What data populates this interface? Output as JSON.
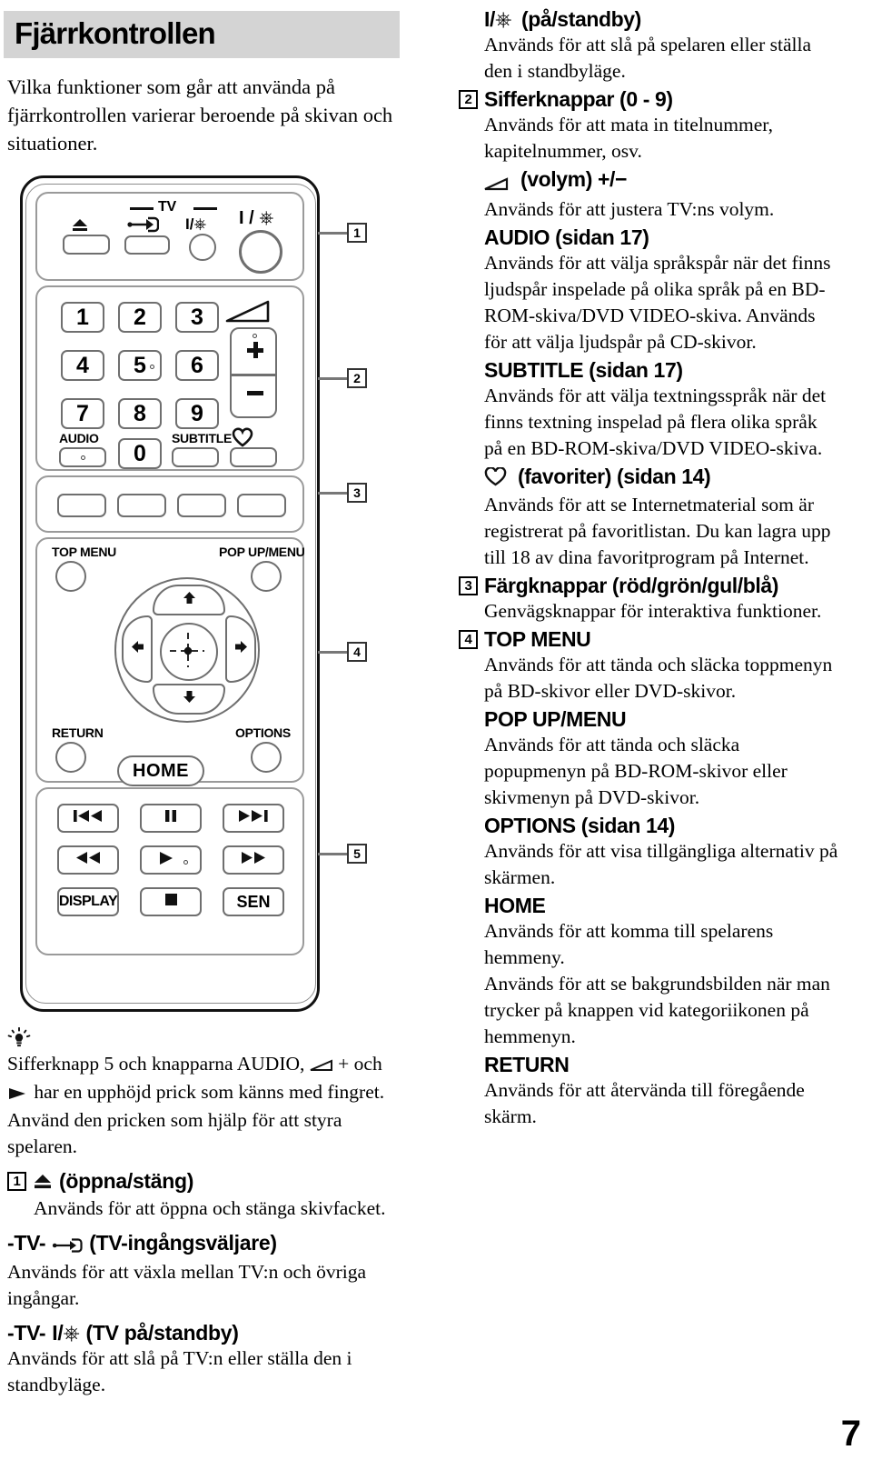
{
  "page": {
    "number": "7",
    "title": "Fjärrkontrollen",
    "intro": "Vilka funktioner som går att använda på fjärrkontrollen varierar beroende på skivan och situationer."
  },
  "remote": {
    "tv_label": "TV",
    "power_label": "I/⏻",
    "tv_power_label": "I/⏻",
    "keys": {
      "n1": "1",
      "n2": "2",
      "n3": "3",
      "n4": "4",
      "n5": "5",
      "n6": "6",
      "n7": "7",
      "n8": "8",
      "n9": "9",
      "n0": "0"
    },
    "labels": {
      "audio": "AUDIO",
      "subtitle": "SUBTITLE",
      "top_menu": "TOP MENU",
      "pop_up_menu": "POP UP/MENU",
      "return": "RETURN",
      "options": "OPTIONS",
      "home": "HOME",
      "display": "DISPLAY",
      "sen": "SEN",
      "vol_plus": "+",
      "vol_minus": "−"
    },
    "icons": {
      "eject": "eject-icon",
      "tv_input": "tv-input-select-icon",
      "power": "power-standby-icon",
      "volume": "volume-wedge-icon",
      "favorites": "heart-favorites-icon",
      "prev": "skip-previous-icon",
      "pause": "pause-icon",
      "next": "skip-next-icon",
      "rewind": "rewind-icon",
      "play": "play-icon",
      "forward": "fast-forward-icon",
      "stop": "stop-icon",
      "up": "arrow-up-icon",
      "down": "arrow-down-icon",
      "left": "arrow-left-icon",
      "right": "arrow-right-icon"
    },
    "callouts": [
      "1",
      "2",
      "3",
      "4",
      "5"
    ]
  },
  "tip": {
    "icon": "lightbulb-tip-icon",
    "text_1": "Sifferknapp 5 och knapparna AUDIO,",
    "text_2": "+ och",
    "text_3": "har en upphöjd prick som känns med fingret. Använd den pricken som hjälp för att styra spelaren."
  },
  "left_entries": [
    {
      "num": "1",
      "head_icon": "eject-icon",
      "head": "(öppna/stäng)",
      "body": "Används för att öppna och stänga skivfacket."
    },
    {
      "num": "",
      "head_prefix": "-TV-",
      "head_icon": "tv-input-select-icon",
      "head": "(TV-ingångsväljare)",
      "body": "Används för att växla mellan TV:n och övriga ingångar."
    },
    {
      "num": "",
      "head_prefix": "-TV-",
      "head_icon": "power-standby-icon",
      "head": "(TV på/standby)",
      "body": "Används för att slå på TV:n eller ställa den i standbyläge."
    }
  ],
  "right_entries": [
    {
      "num": "",
      "icon": "power-standby-icon",
      "head": "(på/standby)",
      "body": "Används för att slå på spelaren eller ställa den i standbyläge."
    },
    {
      "num": "2",
      "icon": "",
      "head": "Sifferknappar (0 - 9)",
      "body": "Används för att mata in titelnummer, kapitelnummer, osv."
    },
    {
      "num": "",
      "icon": "volume-wedge-icon",
      "head": "(volym) +/−",
      "body": "Används för att justera TV:ns volym."
    },
    {
      "num": "",
      "icon": "",
      "head": "AUDIO (sidan 17)",
      "body": "Används för att välja språkspår när det finns ljudspår inspelade på olika språk på en BD-ROM-skiva/DVD VIDEO-skiva. Används för att välja ljudspår på CD-skivor."
    },
    {
      "num": "",
      "icon": "",
      "head": "SUBTITLE (sidan 17)",
      "body": "Används för att välja textningsspråk när det finns textning inspelad på flera olika språk på en BD-ROM-skiva/DVD VIDEO-skiva."
    },
    {
      "num": "",
      "icon": "heart-favorites-icon",
      "head": "(favoriter) (sidan 14)",
      "body": "Används för att se Internetmaterial som är registrerat på favoritlistan. Du kan lagra upp till 18 av dina favoritprogram på Internet."
    },
    {
      "num": "3",
      "icon": "",
      "head": "Färgknappar (röd/grön/gul/blå)",
      "body": "Genvägsknappar för interaktiva funktioner."
    },
    {
      "num": "4",
      "icon": "",
      "head": "TOP MENU",
      "body": "Används för att tända och släcka toppmenyn på BD-skivor eller DVD-skivor."
    },
    {
      "num": "",
      "icon": "",
      "head": "POP UP/MENU",
      "body": "Används för att tända och släcka popupmenyn på BD-ROM-skivor eller skivmenyn på DVD-skivor."
    },
    {
      "num": "",
      "icon": "",
      "head": "OPTIONS (sidan 14)",
      "body": "Används för att visa tillgängliga alternativ på skärmen."
    },
    {
      "num": "",
      "icon": "",
      "head": "HOME",
      "body": "Används för att komma till spelarens hemmeny.\nAnvänds för att se bakgrundsbilden när man trycker på knappen vid kategoriikonen på hemmenyn."
    },
    {
      "num": "",
      "icon": "",
      "head": "RETURN",
      "body": "Används för att återvända till föregående skärm."
    }
  ]
}
